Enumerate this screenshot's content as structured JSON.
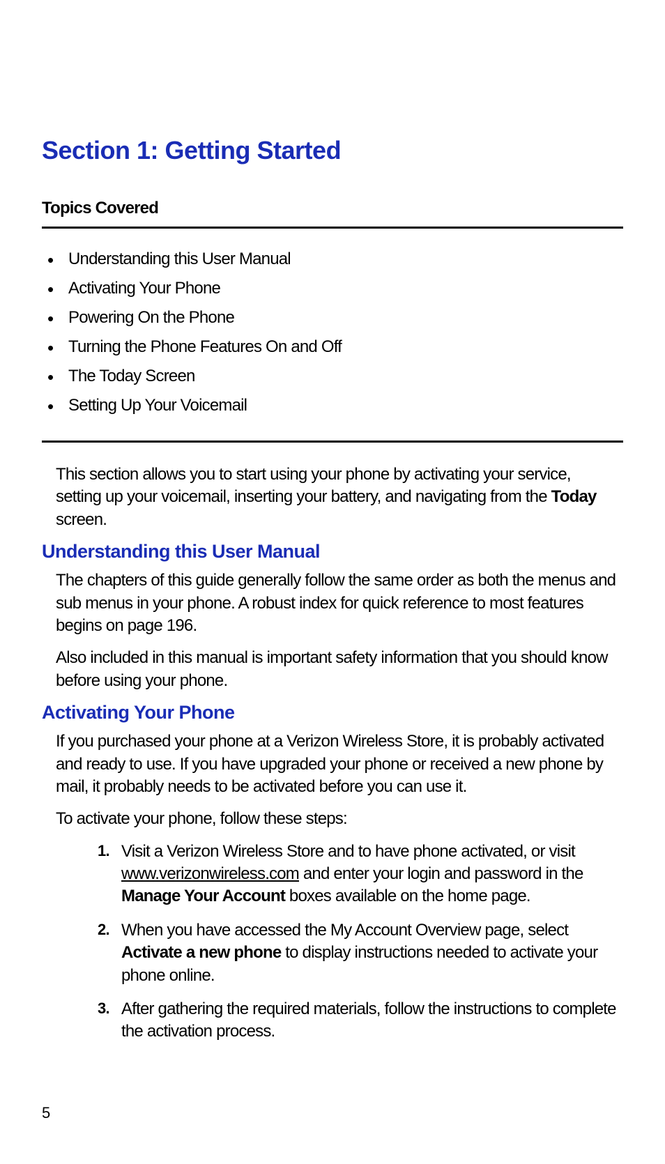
{
  "section_title": "Section 1: Getting Started",
  "topics_header": "Topics Covered",
  "topics": [
    "Understanding this User Manual",
    "Activating Your Phone",
    "Powering On the Phone",
    "Turning the Phone Features On and Off",
    "The Today Screen",
    "Setting Up Your Voicemail"
  ],
  "intro_pre": "This section allows you to start using your phone by activating your service, setting up your voicemail, inserting your battery, and navigating from the ",
  "intro_bold": "Today",
  "intro_post": " screen.",
  "sub1_title": "Understanding this User Manual",
  "sub1_p1": "The chapters of this guide generally follow the same order as both the menus and sub menus in your phone. A robust index for quick reference to most features begins on page 196.",
  "sub1_p2": "Also included in this manual is important safety information that you should know before using your phone.",
  "sub2_title": "Activating Your Phone",
  "sub2_p1": "If you purchased your phone at a Verizon Wireless Store, it is probably activated and ready to use. If you have upgraded your phone or received a new phone by mail, it probably needs to be activated before you can use it.",
  "sub2_p2": "To activate your phone, follow these steps:",
  "steps": {
    "s1_a": "Visit a Verizon Wireless Store and to have phone activated, or visit ",
    "s1_link": "www.verizonwireless.com",
    "s1_b": " and enter your login and password in the ",
    "s1_bold": "Manage Your Account",
    "s1_c": " boxes available on the home page.",
    "s2_a": "When you have accessed the My Account Overview page, select ",
    "s2_bold": "Activate a new phone",
    "s2_b": " to display instructions needed to activate your phone online.",
    "s3": "After gathering the required materials, follow the instructions to complete the activation process."
  },
  "page_number": "5"
}
